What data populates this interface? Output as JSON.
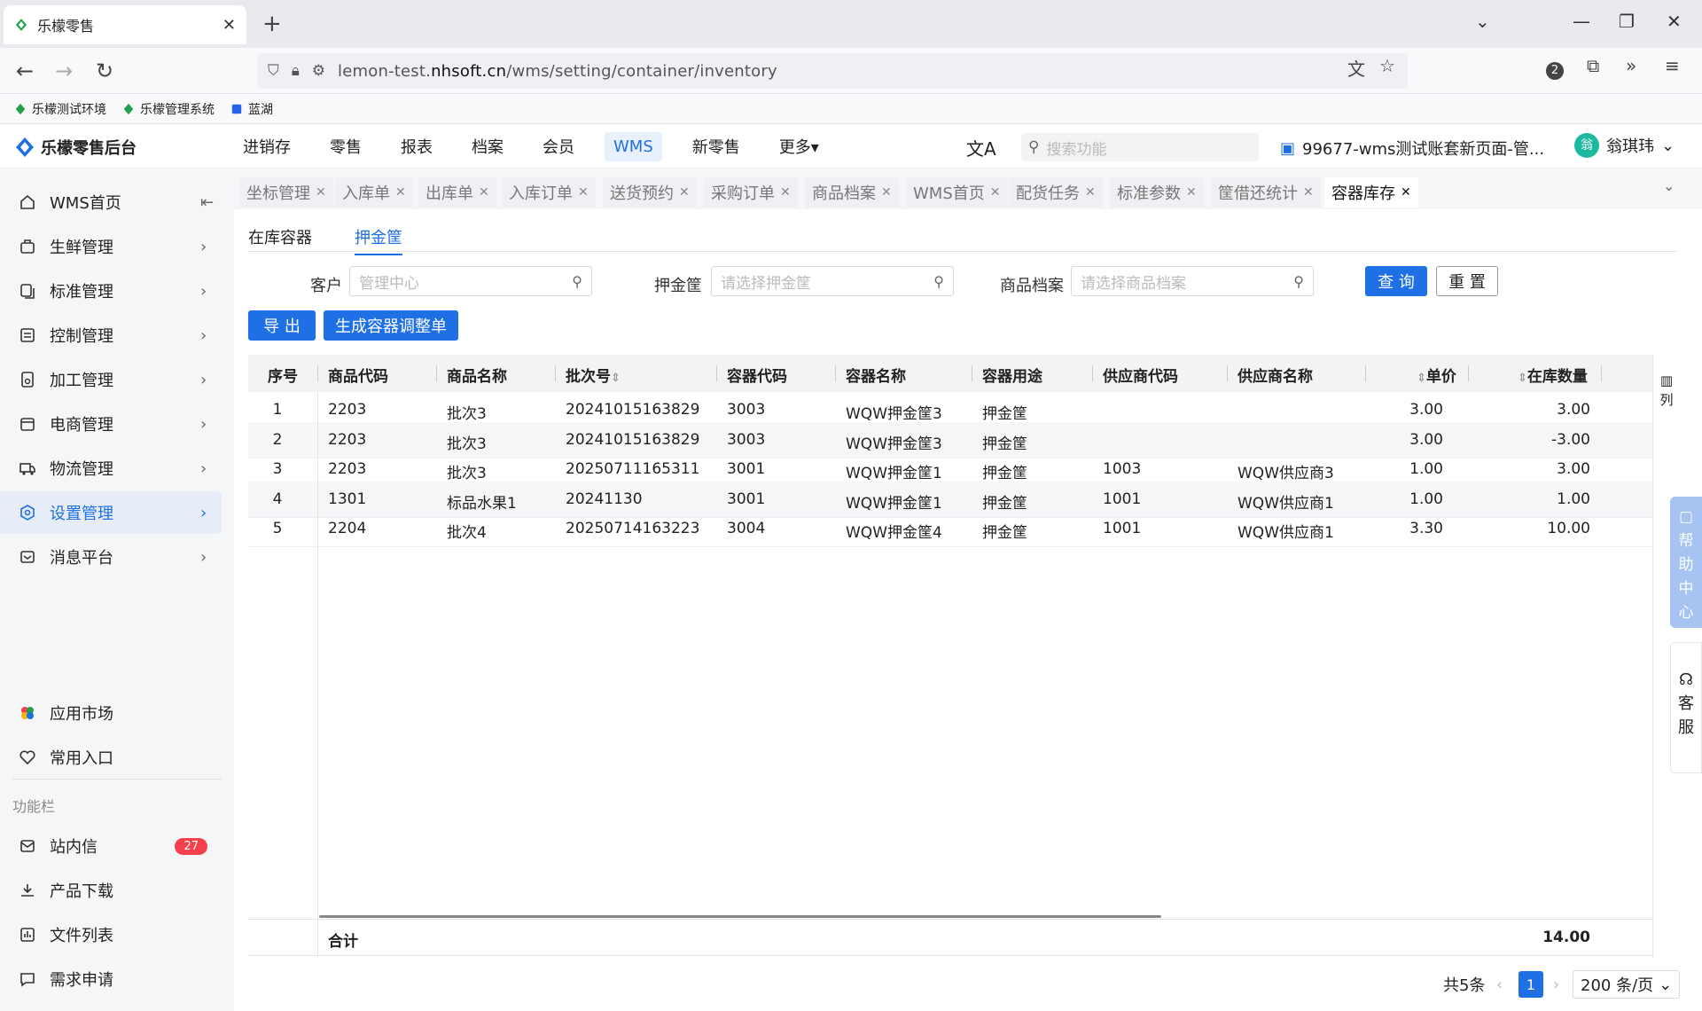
{
  "browser": {
    "tab_title": "乐檬零售",
    "url_prefix": "lemon-test.",
    "url_domain": "nhsoft.cn",
    "url_path": "/wms/setting/container/inventory",
    "ext_badge": "2",
    "bookmarks": [
      "乐檬测试环境",
      "乐檬管理系统",
      "蓝湖"
    ]
  },
  "header": {
    "brand": "乐檬零售后台",
    "menu": [
      "进销存",
      "零售",
      "报表",
      "档案",
      "会员",
      "WMS",
      "新零售",
      "更多▾"
    ],
    "active_menu": "WMS",
    "search_placeholder": "搜索功能",
    "account": "99677-wms测试账套新页面-管...",
    "user_avatar": "翁",
    "user_name": "翁琪玮"
  },
  "sidebar": {
    "items": [
      {
        "label": "WMS首页",
        "icon": "home-icon"
      },
      {
        "label": "生鲜管理",
        "icon": "basket-icon"
      },
      {
        "label": "标准管理",
        "icon": "copy-icon"
      },
      {
        "label": "控制管理",
        "icon": "list-icon"
      },
      {
        "label": "加工管理",
        "icon": "doc-icon"
      },
      {
        "label": "电商管理",
        "icon": "shop-icon"
      },
      {
        "label": "物流管理",
        "icon": "truck-icon"
      },
      {
        "label": "设置管理",
        "icon": "settings-icon"
      },
      {
        "label": "消息平台",
        "icon": "message-icon"
      }
    ],
    "active": "设置管理",
    "bottom_items": [
      {
        "label": "应用市场",
        "icon": "apps-icon"
      },
      {
        "label": "常用入口",
        "icon": "heart-icon"
      }
    ],
    "group_label": "功能栏",
    "tool_items": [
      {
        "label": "站内信",
        "icon": "mail-icon",
        "badge": "27"
      },
      {
        "label": "产品下载",
        "icon": "download-icon"
      },
      {
        "label": "文件列表",
        "icon": "chart-icon"
      },
      {
        "label": "需求申请",
        "icon": "request-icon"
      }
    ]
  },
  "page_tabs": [
    "坐标管理",
    "入库单",
    "出库单",
    "入库订单",
    "送货预约",
    "采购订单",
    "商品档案",
    "WMS首页",
    "配货任务",
    "标准参数",
    "筐借还统计",
    "容器库存"
  ],
  "active_page_tab": "容器库存",
  "subtabs": [
    "在库容器",
    "押金筐"
  ],
  "active_subtab": "押金筐",
  "filters": {
    "customer_label": "客户",
    "customer_placeholder": "管理中心",
    "basket_label": "押金筐",
    "basket_placeholder": "请选择押金筐",
    "product_label": "商品档案",
    "product_placeholder": "请选择商品档案",
    "query_btn": "查 询",
    "reset_btn": "重 置",
    "export_btn": "导 出",
    "generate_btn": "生成容器调整单"
  },
  "table": {
    "headers": [
      "序号",
      "商品代码",
      "商品名称",
      "批次号",
      "容器代码",
      "容器名称",
      "容器用途",
      "供应商代码",
      "供应商名称",
      "单价",
      "在库数量"
    ],
    "rows": [
      [
        "1",
        "2203",
        "批次3",
        "20241015163829",
        "3003",
        "WQW押金筐3",
        "押金筐",
        "",
        "",
        "3.00",
        "3.00"
      ],
      [
        "2",
        "2203",
        "批次3",
        "20241015163829",
        "3003",
        "WQW押金筐3",
        "押金筐",
        "",
        "",
        "3.00",
        "-3.00"
      ],
      [
        "3",
        "2203",
        "批次3",
        "20250711165311",
        "3001",
        "WQW押金筐1",
        "押金筐",
        "1003",
        "WQW供应商3",
        "1.00",
        "3.00"
      ],
      [
        "4",
        "1301",
        "标品水果1",
        "20241130",
        "3001",
        "WQW押金筐1",
        "押金筐",
        "1001",
        "WQW供应商1",
        "1.00",
        "1.00"
      ],
      [
        "5",
        "2204",
        "批次4",
        "20250714163223",
        "3004",
        "WQW押金筐4",
        "押金筐",
        "1001",
        "WQW供应商1",
        "3.30",
        "10.00"
      ]
    ],
    "total_label": "合计",
    "total_qty": "14.00",
    "columns_btn": "列"
  },
  "pager": {
    "total": "共5条",
    "current": "1",
    "page_size": "200 条/页"
  },
  "float": {
    "help": "帮助中心",
    "service": "客服"
  }
}
